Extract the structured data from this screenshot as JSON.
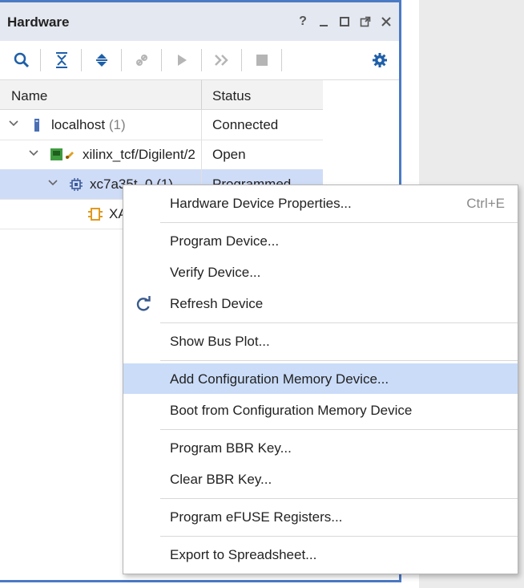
{
  "panel": {
    "title": "Hardware",
    "window_controls": [
      "help-icon",
      "minimize-icon",
      "maximize-icon",
      "float-icon",
      "close-icon"
    ],
    "help_glyph": "?"
  },
  "toolbar": {
    "buttons": [
      "search-icon",
      "collapse-all-icon",
      "expand-all-icon",
      "auto-connect-icon",
      "run-icon",
      "skip-icon",
      "stop-icon",
      "settings-icon"
    ]
  },
  "tree": {
    "columns": {
      "name": "Name",
      "status": "Status"
    },
    "rows": [
      {
        "label": "localhost",
        "count": "(1)",
        "status": "Connected"
      },
      {
        "label": "xilinx_tcf/Digilent/2",
        "status": "Open"
      },
      {
        "label": "xc7a35t_0",
        "count": "(1)",
        "status": "Programmed"
      },
      {
        "label": "XA",
        "status": ""
      }
    ]
  },
  "context_menu": {
    "items": [
      {
        "label": "Hardware Device Properties...",
        "shortcut": "Ctrl+E"
      },
      {
        "label": "Program Device..."
      },
      {
        "label": "Verify Device..."
      },
      {
        "label": "Refresh Device",
        "icon": "refresh-icon"
      },
      {
        "label": "Show Bus Plot..."
      },
      {
        "label": "Add Configuration Memory Device...",
        "highlighted": true
      },
      {
        "label": "Boot from Configuration Memory Device"
      },
      {
        "label": "Program BBR Key..."
      },
      {
        "label": "Clear BBR Key..."
      },
      {
        "label": "Program eFUSE Registers..."
      },
      {
        "label": "Export to Spreadsheet..."
      }
    ]
  },
  "colors": {
    "panel_border": "#4b7ac5",
    "selection": "#cfdcf7",
    "menu_highlight": "#cadcf8",
    "icon_blue": "#1f5fa8"
  }
}
